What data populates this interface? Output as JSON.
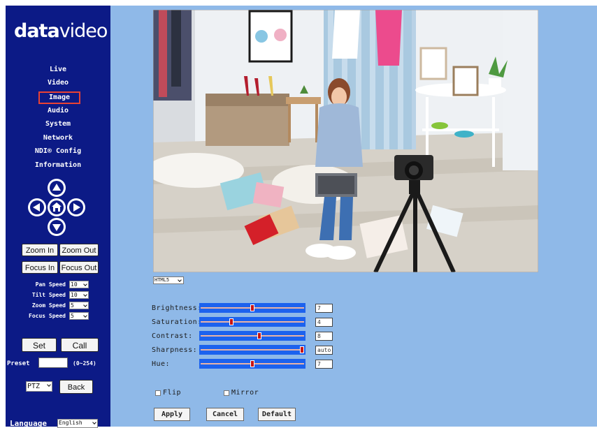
{
  "logo": {
    "bold": "data",
    "light": "video"
  },
  "nav": {
    "items": [
      {
        "label": "Live"
      },
      {
        "label": "Video"
      },
      {
        "label": "Image",
        "active": true
      },
      {
        "label": "Audio"
      },
      {
        "label": "System"
      },
      {
        "label": "Network"
      },
      {
        "label": "NDI® Config"
      },
      {
        "label": "Information"
      }
    ]
  },
  "ptz": {
    "zoom_in": "Zoom In",
    "zoom_out": "Zoom Out",
    "focus_in": "Focus In",
    "focus_out": "Focus Out",
    "pan_speed_label": "Pan Speed",
    "pan_speed": "10",
    "tilt_speed_label": "Tilt Speed",
    "tilt_speed": "10",
    "zoom_speed_label": "Zoom Speed",
    "zoom_speed": "5",
    "focus_speed_label": "Focus Speed",
    "focus_speed": "5",
    "set": "Set",
    "call": "Call",
    "preset_label": "Preset",
    "preset_range": "(0~254)",
    "mode": "PTZ",
    "back": "Back"
  },
  "language": {
    "label": "Language",
    "value": "English"
  },
  "video": {
    "player_mode": "HTML5"
  },
  "image_settings": {
    "brightness": {
      "label": "Brightness:",
      "value": "7",
      "level": 0.5
    },
    "saturation": {
      "label": "Saturation:",
      "value": "4",
      "level": 0.29
    },
    "contrast": {
      "label": "Contrast:",
      "value": "8",
      "level": 0.57
    },
    "sharpness": {
      "label": "Sharpness:",
      "value": "auto",
      "level": 1.0
    },
    "hue": {
      "label": "Hue:",
      "value": "7",
      "level": 0.5
    },
    "flip_label": "Flip",
    "mirror_label": "Mirror"
  },
  "actions": {
    "apply": "Apply",
    "cancel": "Cancel",
    "default": "Default"
  },
  "colors": {
    "sidebar": "#0c1a86",
    "main": "#8fb9e8",
    "slider_track": "#1c62ee",
    "slider_thumb": "#c81414",
    "active_border": "#e84234"
  }
}
